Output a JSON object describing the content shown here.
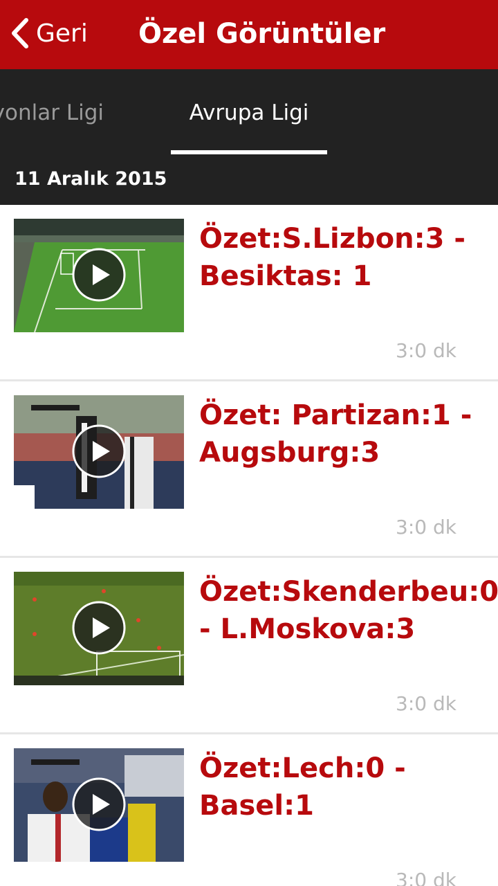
{
  "header": {
    "back_label": "Geri",
    "title": "Özel Görüntüler"
  },
  "tabs": [
    {
      "label": "yonlar Ligi",
      "active": false
    },
    {
      "label": "Avrupa Ligi",
      "active": true
    }
  ],
  "date": "11 Aralık 2015",
  "videos": [
    {
      "title": "Özet:S.Lizbon:3 - Besiktas: 1",
      "duration": "3:0 dk"
    },
    {
      "title": "Özet: Partizan:1 - Augsburg:3",
      "duration": "3:0 dk"
    },
    {
      "title": "Özet:Skenderbeu:0 - L.Moskova:3",
      "duration": "3:0 dk"
    },
    {
      "title": "Özet:Lech:0 - Basel:1",
      "duration": "3:0 dk"
    }
  ],
  "colors": {
    "header": "#b70a0d",
    "tabs_bg": "#222222",
    "title_text": "#b70a0d",
    "duration_text": "#b9b9b9"
  }
}
